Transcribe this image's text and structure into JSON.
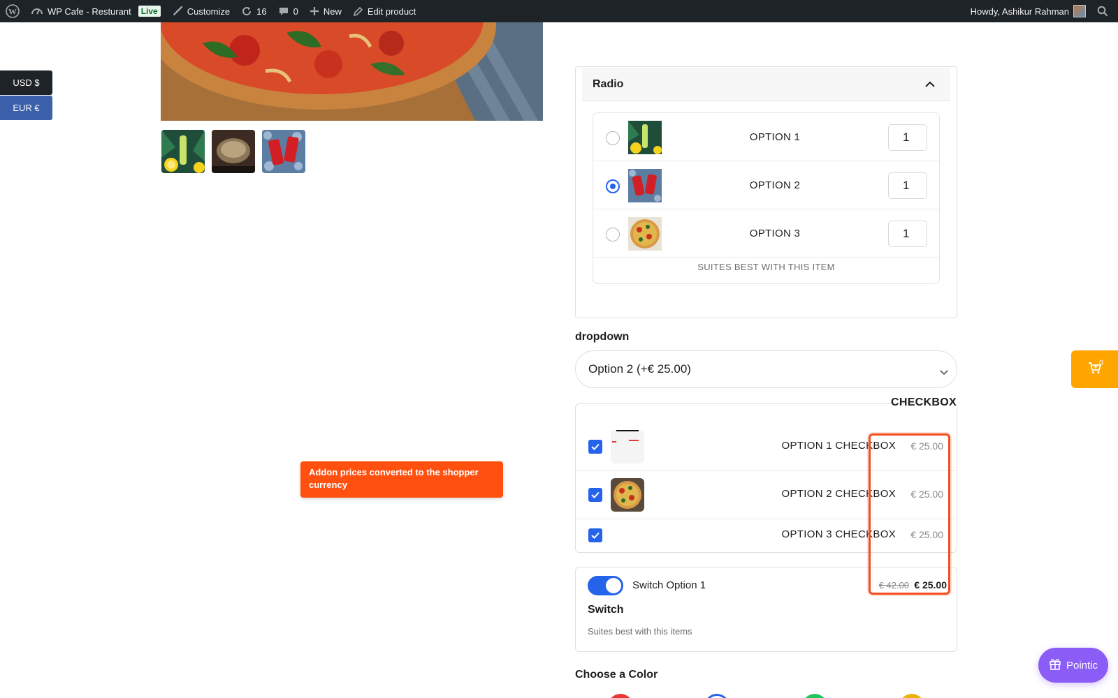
{
  "admin_bar": {
    "site_name": "WP Cafe - Resturant",
    "live_badge": "Live",
    "customize": "Customize",
    "updates_count": "16",
    "comments_count": "0",
    "new_label": "New",
    "edit_label": "Edit product",
    "howdy": "Howdy, Ashikur Rahman"
  },
  "currency": {
    "usd": "USD $",
    "eur": "EUR €"
  },
  "radio_section": {
    "title": "Radio",
    "options": [
      {
        "label": "OPTION 1",
        "qty": "1",
        "selected": false
      },
      {
        "label": "OPTION 2",
        "qty": "1",
        "selected": true
      },
      {
        "label": "OPTION 3",
        "qty": "1",
        "selected": false
      }
    ],
    "note": "SUITES BEST WITH THIS ITEM"
  },
  "dropdown": {
    "label": "dropdown",
    "value": "Option 2 (+€ 25.00)"
  },
  "checkbox_section": {
    "title": "CHECKBOX",
    "options": [
      {
        "label": "OPTION 1 CHECKBOX",
        "price": "€ 25.00",
        "checked": true
      },
      {
        "label": "OPTION 2 CHECKBOX",
        "price": "€ 25.00",
        "checked": true
      },
      {
        "label": "OPTION 3 CHECKBOX",
        "price": "€ 25.00",
        "checked": true
      }
    ]
  },
  "switch_section": {
    "option_label": "Switch Option 1",
    "old_price": "€ 42.00",
    "new_price": "€ 25.00",
    "title": "Switch",
    "note": "Suites best with this items",
    "on": true
  },
  "callout": {
    "text": "Addon prices converted to the shopper currency"
  },
  "color_section": {
    "label": "Choose a Color",
    "swatches": [
      "#e53935",
      "#2563eb",
      "#22c55e",
      "#eab308"
    ]
  },
  "cart": {
    "count": "0"
  },
  "pointic": {
    "label": "Pointic"
  },
  "colors": {
    "accent_blue": "#2563eb",
    "highlight": "#f24e1e",
    "cart_orange": "#ffa500",
    "pointic_purple": "#8b5cf6"
  },
  "icons": {
    "wordpress": "wordpress-icon",
    "site": "dashboard-icon",
    "customize": "brush-icon",
    "updates": "refresh-icon",
    "comments": "comment-icon",
    "new": "plus-icon",
    "edit": "pencil-icon",
    "search": "search-icon",
    "cart": "cart-icon",
    "gift": "gift-icon"
  }
}
